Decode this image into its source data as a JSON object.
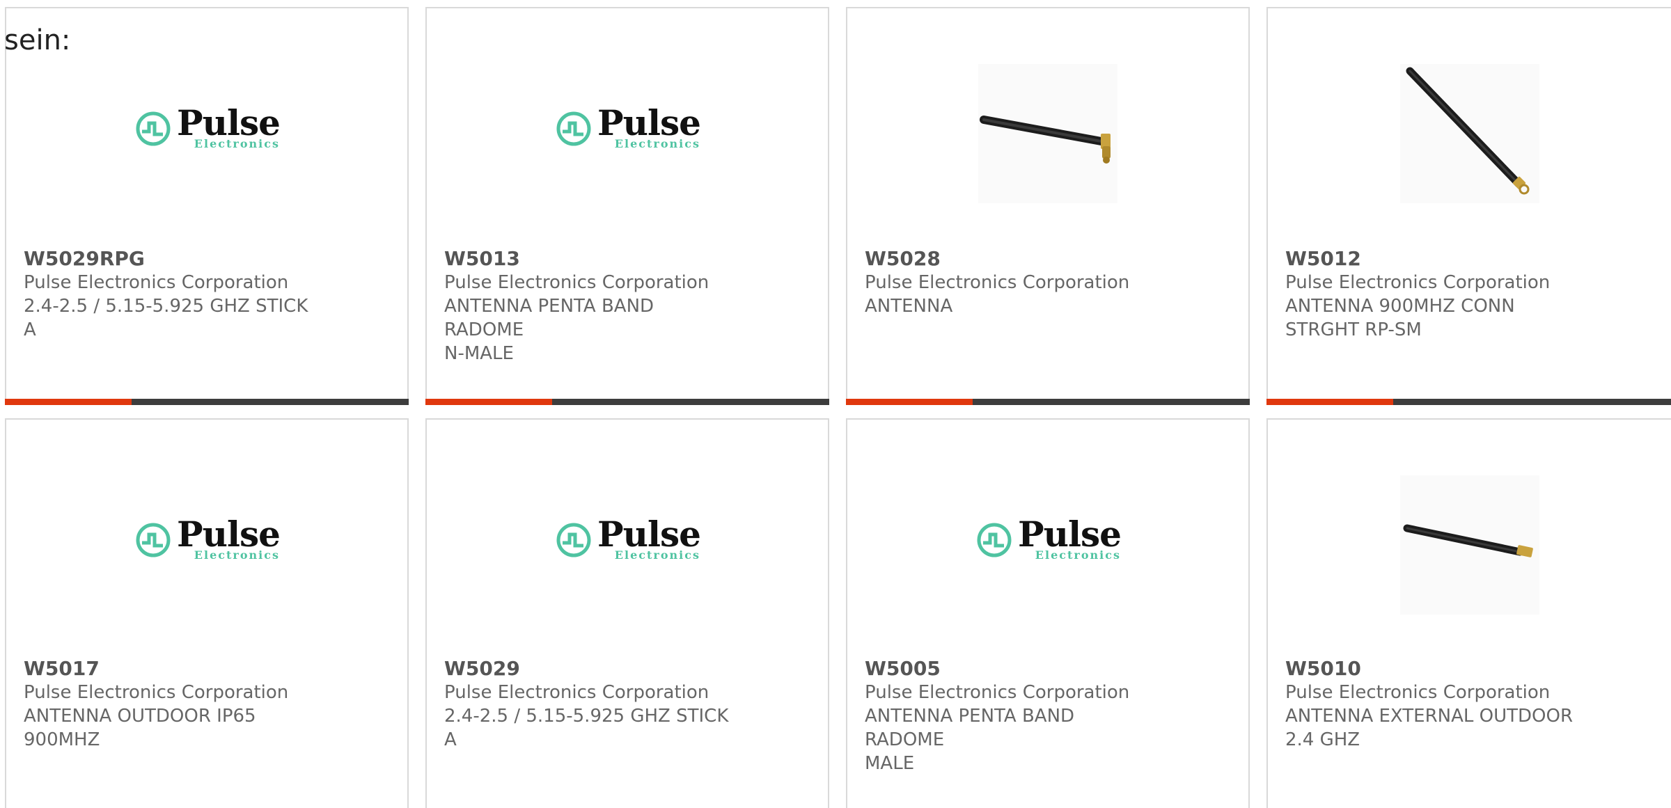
{
  "intro_text": "sein:",
  "brand": {
    "logo_word": "Pulse",
    "logo_sub": "Electronics",
    "logo_color": "#4fc3a1",
    "accent_color": "#e0380e",
    "bar_color": "#3d3d3d"
  },
  "products": [
    {
      "part_number": "W5029RPG",
      "manufacturer": "Pulse Electronics Corporation",
      "desc_line1": "2.4-2.5 / 5.15-5.925 GHZ STICK",
      "desc_line2": "A",
      "image": "pulse-logo"
    },
    {
      "part_number": "W5013",
      "manufacturer": "Pulse Electronics Corporation",
      "desc_line1": "ANTENNA PENTA BAND RADOME",
      "desc_line2": "N-MALE",
      "image": "pulse-logo"
    },
    {
      "part_number": "W5028",
      "manufacturer": "Pulse Electronics Corporation",
      "desc_line1": "ANTENNA",
      "desc_line2": "",
      "image": "antenna-right-angle"
    },
    {
      "part_number": "W5012",
      "manufacturer": "Pulse Electronics Corporation",
      "desc_line1": "ANTENNA 900MHZ CONN",
      "desc_line2": "STRGHT RP-SM",
      "image": "antenna-diagonal"
    },
    {
      "part_number": "W5017",
      "manufacturer": "Pulse Electronics Corporation",
      "desc_line1": "ANTENNA OUTDOOR IP65",
      "desc_line2": "900MHZ",
      "image": "pulse-logo"
    },
    {
      "part_number": "W5029",
      "manufacturer": "Pulse Electronics Corporation",
      "desc_line1": "2.4-2.5 / 5.15-5.925 GHZ STICK",
      "desc_line2": "A",
      "image": "pulse-logo"
    },
    {
      "part_number": "W5005",
      "manufacturer": "Pulse Electronics Corporation",
      "desc_line1": "ANTENNA PENTA BAND RADOME",
      "desc_line2": "MALE",
      "image": "pulse-logo"
    },
    {
      "part_number": "W5010",
      "manufacturer": "Pulse Electronics Corporation",
      "desc_line1": "ANTENNA EXTERNAL OUTDOOR",
      "desc_line2": "2.4 GHZ",
      "image": "antenna-straight"
    }
  ]
}
